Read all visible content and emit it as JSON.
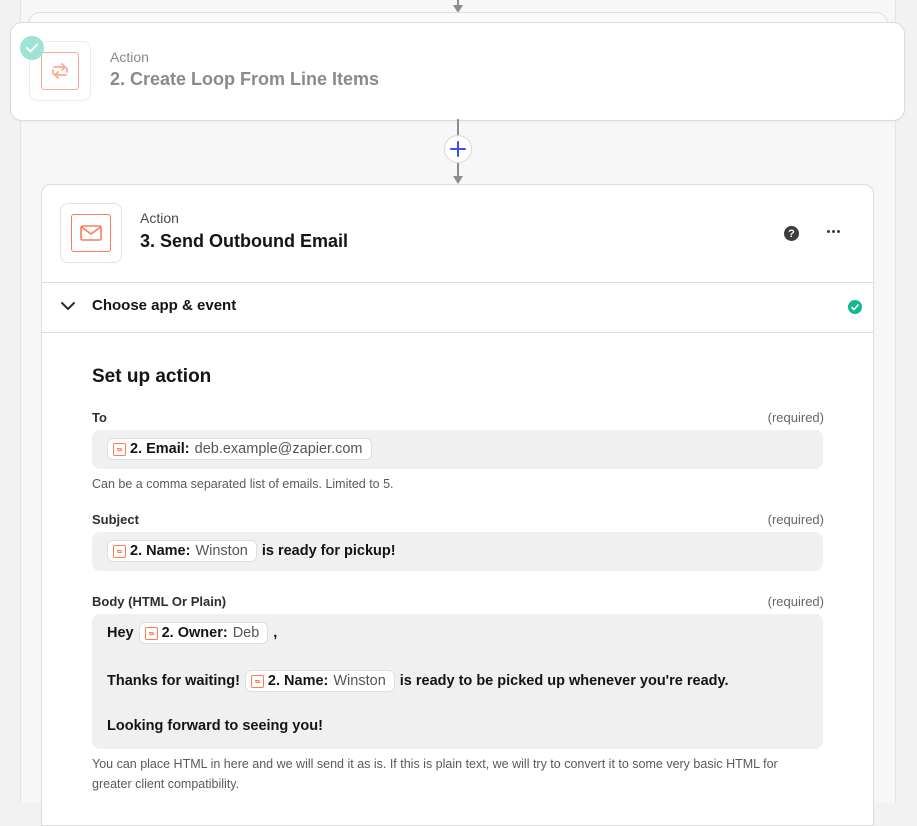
{
  "step2": {
    "kind": "Action",
    "title": "2. Create Loop From Line Items",
    "icon": "loop-icon",
    "status": "check-icon"
  },
  "connector": {
    "icon": "plus-icon"
  },
  "step3": {
    "kind": "Action",
    "title": "3. Send Outbound Email",
    "icon": "mail-icon",
    "help_symbol": "?",
    "section": {
      "label": "Choose app & event",
      "status_icon": "check-circle-icon"
    },
    "setup": {
      "title": "Set up action",
      "to": {
        "label": "To",
        "required": "(required)",
        "pill": {
          "key": "2. Email:",
          "value": "deb.example@zapier.com"
        },
        "hint": "Can be a comma separated list of emails. Limited to 5."
      },
      "subject": {
        "label": "Subject",
        "required": "(required)",
        "pill": {
          "key": "2. Name:",
          "value": "Winston"
        },
        "suffix": "is ready for pickup!"
      },
      "body": {
        "label": "Body (HTML Or Plain)",
        "required": "(required)",
        "line1_prefix": "Hey",
        "line1_pill": {
          "key": "2. Owner:",
          "value": "Deb"
        },
        "line1_suffix": ",",
        "line2_prefix": "Thanks for waiting!",
        "line2_pill": {
          "key": "2. Name:",
          "value": "Winston"
        },
        "line2_suffix": "is ready to be picked up whenever you're ready.",
        "line3": "Looking forward to seeing you!",
        "hint": "You can place HTML in here and we will send it as is. If this is plain text, we will try to convert it to some very basic HTML for greater client compatibility."
      }
    }
  },
  "colors": {
    "accent": "#ff7a59",
    "success": "#13b890",
    "link": "#3d4eea"
  }
}
